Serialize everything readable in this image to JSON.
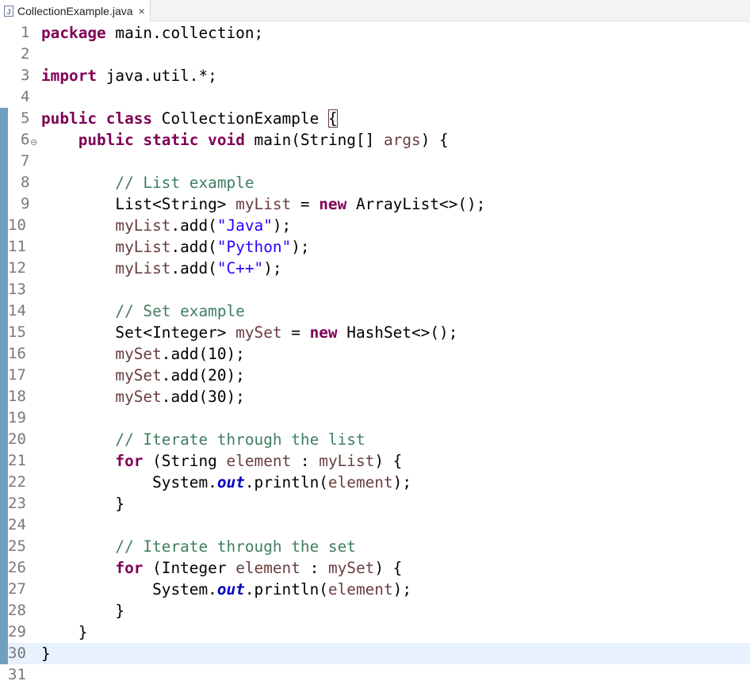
{
  "tab": {
    "title": "CollectionExample.java",
    "close_glyph": "×",
    "icon": "java-file-icon"
  },
  "editor": {
    "current_line": 30,
    "lines": [
      {
        "n": "1",
        "tokens": [
          {
            "t": "kw",
            "v": "package"
          },
          {
            "t": "p",
            "v": " main.collection;"
          }
        ]
      },
      {
        "n": "2",
        "tokens": []
      },
      {
        "n": "3",
        "tokens": [
          {
            "t": "kw",
            "v": "import"
          },
          {
            "t": "p",
            "v": " java.util.*;"
          }
        ]
      },
      {
        "n": "4",
        "tokens": []
      },
      {
        "n": "5",
        "tokens": [
          {
            "t": "kw",
            "v": "public"
          },
          {
            "t": "p",
            "v": " "
          },
          {
            "t": "kw",
            "v": "class"
          },
          {
            "t": "p",
            "v": " CollectionExample "
          },
          {
            "t": "box",
            "v": "{"
          }
        ]
      },
      {
        "n": "6",
        "fold": true,
        "tokens": [
          {
            "t": "p",
            "v": "    "
          },
          {
            "t": "kw",
            "v": "public"
          },
          {
            "t": "p",
            "v": " "
          },
          {
            "t": "kw",
            "v": "static"
          },
          {
            "t": "p",
            "v": " "
          },
          {
            "t": "kw",
            "v": "void"
          },
          {
            "t": "p",
            "v": " main(String[] "
          },
          {
            "t": "vr",
            "v": "args"
          },
          {
            "t": "p",
            "v": ") {"
          }
        ]
      },
      {
        "n": "7",
        "tokens": []
      },
      {
        "n": "8",
        "tokens": [
          {
            "t": "p",
            "v": "        "
          },
          {
            "t": "cm",
            "v": "// List example"
          }
        ]
      },
      {
        "n": "9",
        "tokens": [
          {
            "t": "p",
            "v": "        List<String> "
          },
          {
            "t": "vr",
            "v": "myList"
          },
          {
            "t": "p",
            "v": " = "
          },
          {
            "t": "kw",
            "v": "new"
          },
          {
            "t": "p",
            "v": " ArrayList<>();"
          }
        ]
      },
      {
        "n": "10",
        "tokens": [
          {
            "t": "p",
            "v": "        "
          },
          {
            "t": "vr",
            "v": "myList"
          },
          {
            "t": "p",
            "v": ".add("
          },
          {
            "t": "st",
            "v": "\"Java\""
          },
          {
            "t": "p",
            "v": ");"
          }
        ]
      },
      {
        "n": "11",
        "tokens": [
          {
            "t": "p",
            "v": "        "
          },
          {
            "t": "vr",
            "v": "myList"
          },
          {
            "t": "p",
            "v": ".add("
          },
          {
            "t": "st",
            "v": "\"Python\""
          },
          {
            "t": "p",
            "v": ");"
          }
        ]
      },
      {
        "n": "12",
        "tokens": [
          {
            "t": "p",
            "v": "        "
          },
          {
            "t": "vr",
            "v": "myList"
          },
          {
            "t": "p",
            "v": ".add("
          },
          {
            "t": "st",
            "v": "\"C++\""
          },
          {
            "t": "p",
            "v": ");"
          }
        ]
      },
      {
        "n": "13",
        "tokens": []
      },
      {
        "n": "14",
        "tokens": [
          {
            "t": "p",
            "v": "        "
          },
          {
            "t": "cm",
            "v": "// Set example"
          }
        ]
      },
      {
        "n": "15",
        "tokens": [
          {
            "t": "p",
            "v": "        Set<Integer> "
          },
          {
            "t": "vr",
            "v": "mySet"
          },
          {
            "t": "p",
            "v": " = "
          },
          {
            "t": "kw",
            "v": "new"
          },
          {
            "t": "p",
            "v": " HashSet<>();"
          }
        ]
      },
      {
        "n": "16",
        "tokens": [
          {
            "t": "p",
            "v": "        "
          },
          {
            "t": "vr",
            "v": "mySet"
          },
          {
            "t": "p",
            "v": ".add(10);"
          }
        ]
      },
      {
        "n": "17",
        "tokens": [
          {
            "t": "p",
            "v": "        "
          },
          {
            "t": "vr",
            "v": "mySet"
          },
          {
            "t": "p",
            "v": ".add(20);"
          }
        ]
      },
      {
        "n": "18",
        "tokens": [
          {
            "t": "p",
            "v": "        "
          },
          {
            "t": "vr",
            "v": "mySet"
          },
          {
            "t": "p",
            "v": ".add(30);"
          }
        ]
      },
      {
        "n": "19",
        "tokens": []
      },
      {
        "n": "20",
        "tokens": [
          {
            "t": "p",
            "v": "        "
          },
          {
            "t": "cm",
            "v": "// Iterate through the list"
          }
        ]
      },
      {
        "n": "21",
        "tokens": [
          {
            "t": "p",
            "v": "        "
          },
          {
            "t": "kw",
            "v": "for"
          },
          {
            "t": "p",
            "v": " (String "
          },
          {
            "t": "vr",
            "v": "element"
          },
          {
            "t": "p",
            "v": " : "
          },
          {
            "t": "vr",
            "v": "myList"
          },
          {
            "t": "p",
            "v": ") {"
          }
        ]
      },
      {
        "n": "22",
        "tokens": [
          {
            "t": "p",
            "v": "            System."
          },
          {
            "t": "sf",
            "v": "out"
          },
          {
            "t": "p",
            "v": ".println("
          },
          {
            "t": "vr",
            "v": "element"
          },
          {
            "t": "p",
            "v": ");"
          }
        ]
      },
      {
        "n": "23",
        "tokens": [
          {
            "t": "p",
            "v": "        }"
          }
        ]
      },
      {
        "n": "24",
        "tokens": []
      },
      {
        "n": "25",
        "tokens": [
          {
            "t": "p",
            "v": "        "
          },
          {
            "t": "cm",
            "v": "// Iterate through the set"
          }
        ]
      },
      {
        "n": "26",
        "tokens": [
          {
            "t": "p",
            "v": "        "
          },
          {
            "t": "kw",
            "v": "for"
          },
          {
            "t": "p",
            "v": " (Integer "
          },
          {
            "t": "vr",
            "v": "element"
          },
          {
            "t": "p",
            "v": " : "
          },
          {
            "t": "vr",
            "v": "mySet"
          },
          {
            "t": "p",
            "v": ") {"
          }
        ]
      },
      {
        "n": "27",
        "tokens": [
          {
            "t": "p",
            "v": "            System."
          },
          {
            "t": "sf",
            "v": "out"
          },
          {
            "t": "p",
            "v": ".println("
          },
          {
            "t": "vr",
            "v": "element"
          },
          {
            "t": "p",
            "v": ");"
          }
        ]
      },
      {
        "n": "28",
        "tokens": [
          {
            "t": "p",
            "v": "        }"
          }
        ]
      },
      {
        "n": "29",
        "tokens": [
          {
            "t": "p",
            "v": "    }"
          }
        ]
      },
      {
        "n": "30",
        "tokens": [
          {
            "t": "p",
            "v": "}"
          }
        ]
      },
      {
        "n": "31",
        "tokens": []
      }
    ],
    "colors": {
      "keyword": "#7f0055",
      "comment": "#3f7f5f",
      "string": "#2a00ff",
      "local_variable": "#6a3e3e",
      "static_field": "#0000c0",
      "current_line_bg": "#e8f2fe",
      "change_bar": "#6f9fbf"
    }
  }
}
